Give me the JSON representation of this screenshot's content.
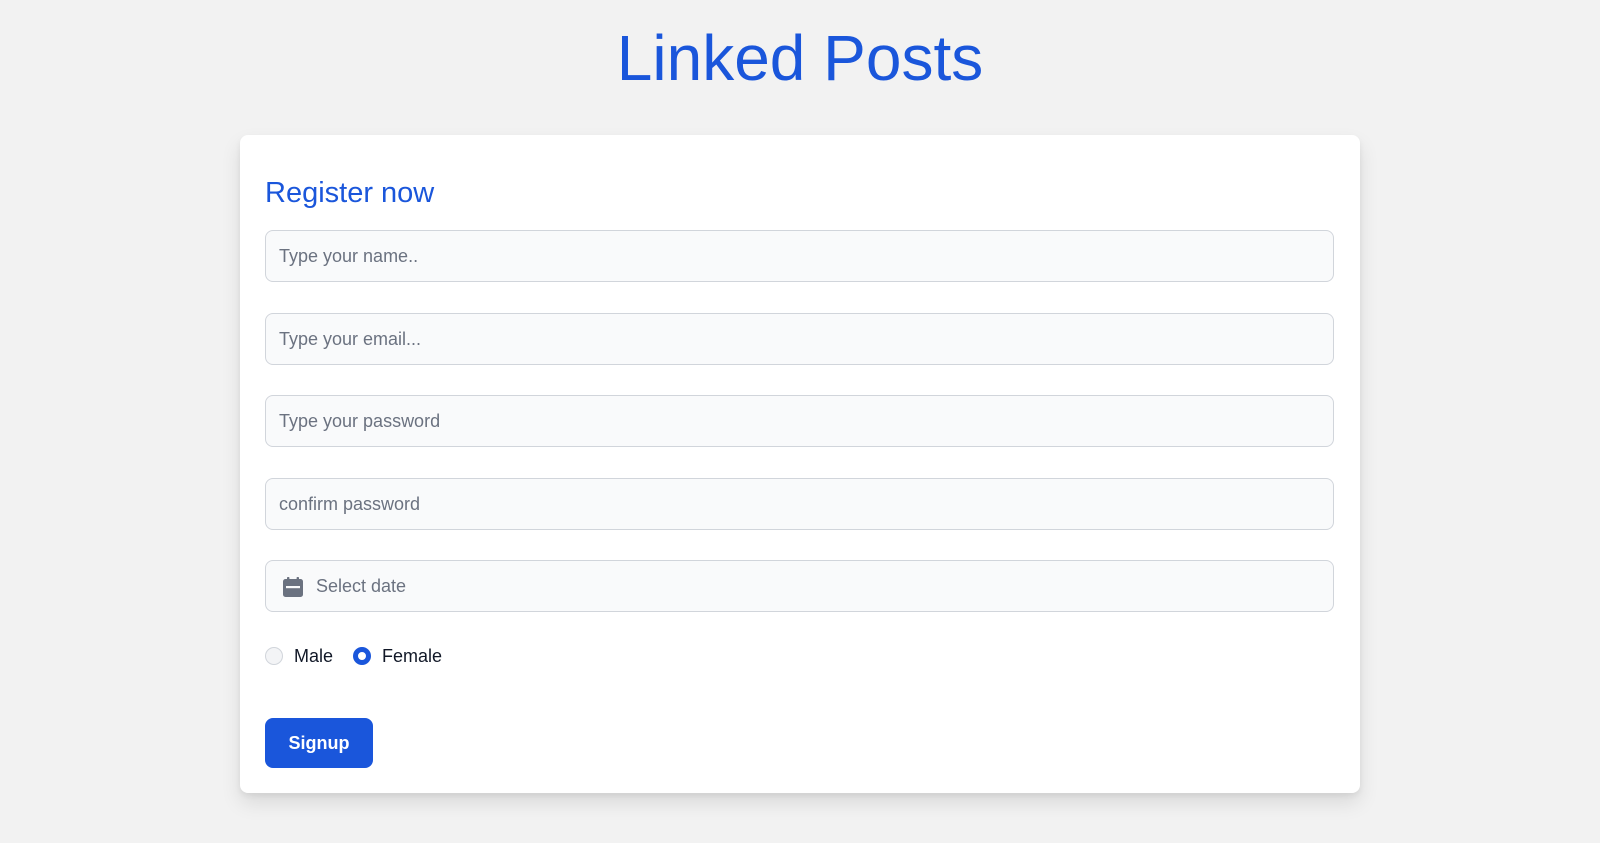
{
  "header": {
    "title": "Linked Posts"
  },
  "form": {
    "title": "Register now",
    "name_placeholder": "Type your name..",
    "email_placeholder": "Type your email...",
    "password_placeholder": "Type your password",
    "confirm_placeholder": "confirm password",
    "date_placeholder": "Select date",
    "date_icon": "calendar-icon",
    "gender_options": [
      {
        "label": "Male",
        "checked": false
      },
      {
        "label": "Female",
        "checked": true
      }
    ],
    "submit_label": "Signup"
  },
  "colors": {
    "accent": "#1a56db",
    "background": "#f2f2f2",
    "card": "#ffffff",
    "field_border": "#d1d5db",
    "placeholder": "#6b7280"
  }
}
